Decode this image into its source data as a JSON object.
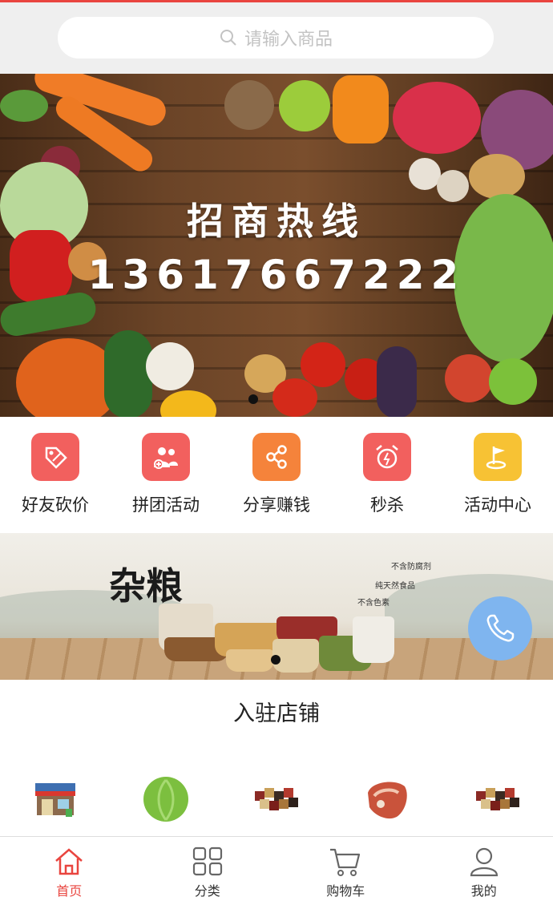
{
  "search": {
    "placeholder": "请输入商品"
  },
  "banner": {
    "title": "招商热线",
    "phone": "13617667222"
  },
  "menu": [
    {
      "label": "好友砍价",
      "icon": "bargain-tag-icon",
      "color": "#f2605e"
    },
    {
      "label": "拼团活动",
      "icon": "group-users-icon",
      "color": "#f2605e"
    },
    {
      "label": "分享赚钱",
      "icon": "share-icon",
      "color": "#f5833b"
    },
    {
      "label": "秒杀",
      "icon": "alarm-clock-icon",
      "color": "#f2605e"
    },
    {
      "label": "活动中心",
      "icon": "flag-icon",
      "color": "#f7c234"
    }
  ],
  "promo": {
    "title": "杂粮",
    "tags": [
      "不含防腐剂",
      "纯天然食品",
      "不含色素"
    ]
  },
  "section": {
    "title": "入驻店铺"
  },
  "shops": [
    "storefront-icon",
    "cabbage-icon",
    "mixed-grains-icon",
    "meat-steak-icon",
    "mixed-grains-icon"
  ],
  "tabs": [
    {
      "label": "首页",
      "icon": "home-icon",
      "active": true
    },
    {
      "label": "分类",
      "icon": "grid-icon",
      "active": false
    },
    {
      "label": "购物车",
      "icon": "cart-icon",
      "active": false
    },
    {
      "label": "我的",
      "icon": "user-icon",
      "active": false
    }
  ],
  "colors": {
    "accent": "#e9453f",
    "call_button": "#7fb5ef"
  }
}
